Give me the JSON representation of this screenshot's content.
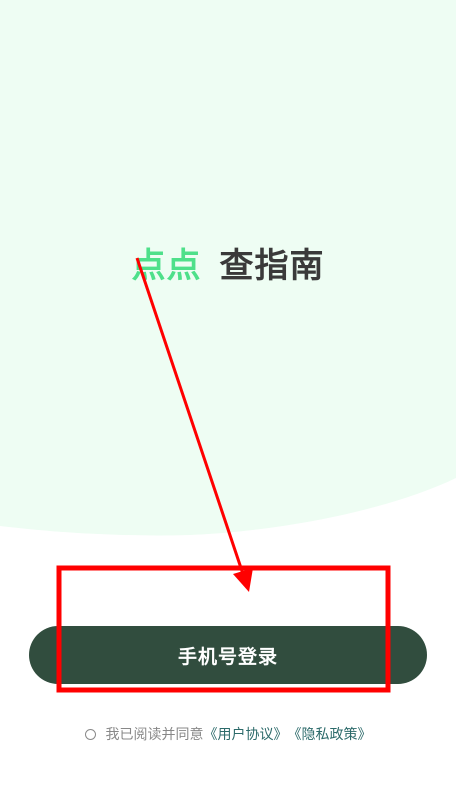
{
  "logo": {
    "accent": "点点",
    "main": "查指南"
  },
  "login": {
    "button_label": "手机号登录"
  },
  "agreement": {
    "prefix": "我已阅读并同意",
    "user_agreement": "《用户协议》",
    "privacy_policy": "《隐私政策》"
  },
  "colors": {
    "hero_bg": "#eefdf3",
    "accent": "#4ee08a",
    "button": "#314d3e",
    "annotation": "#ff0000"
  }
}
